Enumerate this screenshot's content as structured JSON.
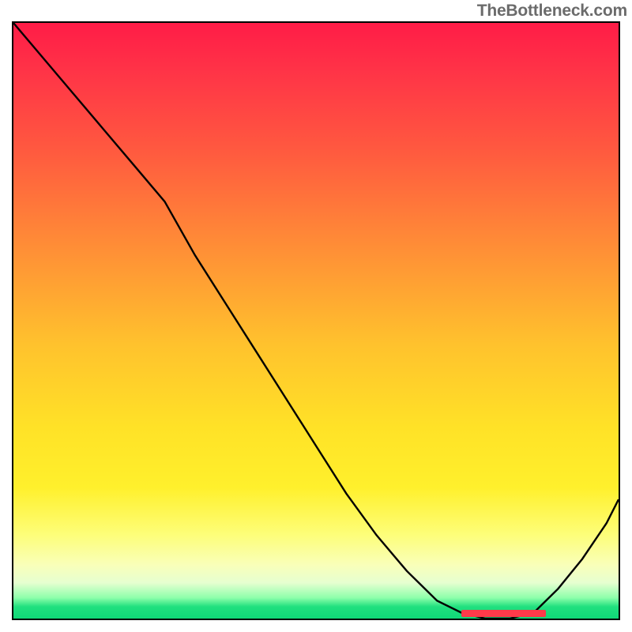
{
  "attribution": "TheBottleneck.com",
  "colors": {
    "gradient_top": "#ff1c47",
    "gradient_mid": "#ffe227",
    "gradient_bottom": "#0fd877",
    "curve": "#000000",
    "marker": "#ff3a4a",
    "frame": "#000000"
  },
  "chart_data": {
    "type": "line",
    "title": "",
    "xlabel": "",
    "ylabel": "",
    "xlim": [
      0,
      100
    ],
    "ylim": [
      0,
      100
    ],
    "grid": false,
    "legend": false,
    "series": [
      {
        "name": "bottleneck-curve",
        "x": [
          0,
          5,
          10,
          15,
          20,
          25,
          30,
          35,
          40,
          45,
          50,
          55,
          60,
          65,
          70,
          74,
          78,
          82,
          86,
          90,
          94,
          98,
          100
        ],
        "y": [
          100,
          94,
          88,
          82,
          76,
          70,
          61,
          53,
          45,
          37,
          29,
          21,
          14,
          8,
          3,
          1,
          0,
          0,
          1,
          5,
          10,
          16,
          20
        ]
      }
    ],
    "annotations": [
      {
        "name": "optimal-range-marker",
        "x_start": 74,
        "x_end": 88,
        "y": 0
      }
    ]
  }
}
